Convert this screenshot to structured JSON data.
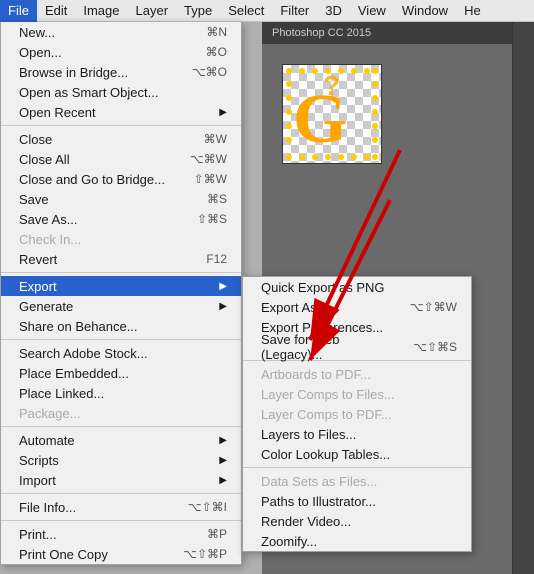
{
  "menubar": {
    "items": [
      {
        "label": "File",
        "active": true
      },
      {
        "label": "Edit",
        "active": false
      },
      {
        "label": "Image",
        "active": false
      },
      {
        "label": "Layer",
        "active": false
      },
      {
        "label": "Type",
        "active": false
      },
      {
        "label": "Select",
        "active": false
      },
      {
        "label": "Filter",
        "active": false
      },
      {
        "label": "3D",
        "active": false
      },
      {
        "label": "View",
        "active": false
      },
      {
        "label": "Window",
        "active": false
      },
      {
        "label": "He",
        "active": false
      }
    ]
  },
  "file_menu": {
    "items": [
      {
        "label": "New...",
        "shortcut": "⌘N",
        "disabled": false,
        "separator_after": false
      },
      {
        "label": "Open...",
        "shortcut": "⌘O",
        "disabled": false,
        "separator_after": false
      },
      {
        "label": "Browse in Bridge...",
        "shortcut": "⌥⌘O",
        "disabled": false,
        "separator_after": false
      },
      {
        "label": "Open as Smart Object...",
        "shortcut": "",
        "disabled": false,
        "separator_after": false
      },
      {
        "label": "Open Recent",
        "shortcut": "",
        "has_arrow": true,
        "disabled": false,
        "separator_after": true
      },
      {
        "label": "Close",
        "shortcut": "⌘W",
        "disabled": false,
        "separator_after": false
      },
      {
        "label": "Close All",
        "shortcut": "⌥⌘W",
        "disabled": false,
        "separator_after": false
      },
      {
        "label": "Close and Go to Bridge...",
        "shortcut": "⇧⌘W",
        "disabled": false,
        "separator_after": false
      },
      {
        "label": "Save",
        "shortcut": "⌘S",
        "disabled": false,
        "separator_after": false
      },
      {
        "label": "Save As...",
        "shortcut": "⇧⌘S",
        "disabled": false,
        "separator_after": false
      },
      {
        "label": "Check In...",
        "shortcut": "",
        "disabled": true,
        "separator_after": false
      },
      {
        "label": "Revert",
        "shortcut": "F12",
        "disabled": false,
        "separator_after": true
      },
      {
        "label": "Export",
        "shortcut": "",
        "has_arrow": true,
        "active": true,
        "disabled": false,
        "separator_after": false
      },
      {
        "label": "Generate",
        "shortcut": "",
        "has_arrow": true,
        "disabled": false,
        "separator_after": false
      },
      {
        "label": "Share on Behance...",
        "shortcut": "",
        "disabled": false,
        "separator_after": true
      },
      {
        "label": "Search Adobe Stock...",
        "shortcut": "",
        "disabled": false,
        "separator_after": false
      },
      {
        "label": "Place Embedded...",
        "shortcut": "",
        "disabled": false,
        "separator_after": false
      },
      {
        "label": "Place Linked...",
        "shortcut": "",
        "disabled": false,
        "separator_after": false
      },
      {
        "label": "Package...",
        "shortcut": "",
        "disabled": true,
        "separator_after": true
      },
      {
        "label": "Automate",
        "shortcut": "",
        "has_arrow": true,
        "disabled": false,
        "separator_after": false
      },
      {
        "label": "Scripts",
        "shortcut": "",
        "has_arrow": true,
        "disabled": false,
        "separator_after": false
      },
      {
        "label": "Import",
        "shortcut": "",
        "has_arrow": true,
        "disabled": false,
        "separator_after": true
      },
      {
        "label": "File Info...",
        "shortcut": "⌥⇧⌘I",
        "disabled": false,
        "separator_after": true
      },
      {
        "label": "Print...",
        "shortcut": "⌘P",
        "disabled": false,
        "separator_after": false
      },
      {
        "label": "Print One Copy",
        "shortcut": "⌥⇧⌘P",
        "disabled": false,
        "separator_after": false
      }
    ]
  },
  "export_submenu": {
    "items": [
      {
        "label": "Quick Export as PNG",
        "shortcut": "",
        "disabled": false
      },
      {
        "label": "Export As...",
        "shortcut": "⌥⇧⌘W",
        "disabled": false
      },
      {
        "label": "Export Preferences...",
        "shortcut": "",
        "disabled": false
      },
      {
        "label": "Save for Web (Legacy)...",
        "shortcut": "⌥⇧⌘S",
        "disabled": false
      },
      {
        "label": "",
        "separator": true
      },
      {
        "label": "Artboards to PDF...",
        "shortcut": "",
        "disabled": true
      },
      {
        "label": "Layer Comps to Files...",
        "shortcut": "",
        "disabled": true
      },
      {
        "label": "Layer Comps to PDF...",
        "shortcut": "",
        "disabled": true
      },
      {
        "label": "Layers to Files...",
        "shortcut": "",
        "disabled": false
      },
      {
        "label": "Color Lookup Tables...",
        "shortcut": "",
        "disabled": false
      },
      {
        "label": "",
        "separator": true
      },
      {
        "label": "Data Sets as Files...",
        "shortcut": "",
        "disabled": true
      },
      {
        "label": "Paths to Illustrator...",
        "shortcut": "",
        "disabled": false
      },
      {
        "label": "Render Video...",
        "shortcut": "",
        "disabled": false
      },
      {
        "label": "Zoomify...",
        "shortcut": "",
        "disabled": false
      }
    ]
  },
  "canvas": {
    "title": "Photoshop CC 2015"
  },
  "colors": {
    "active_blue": "#2961cc",
    "menu_bg": "#f0f0f0",
    "disabled_text": "#aaaaaa",
    "orange": "#ff8c00"
  }
}
